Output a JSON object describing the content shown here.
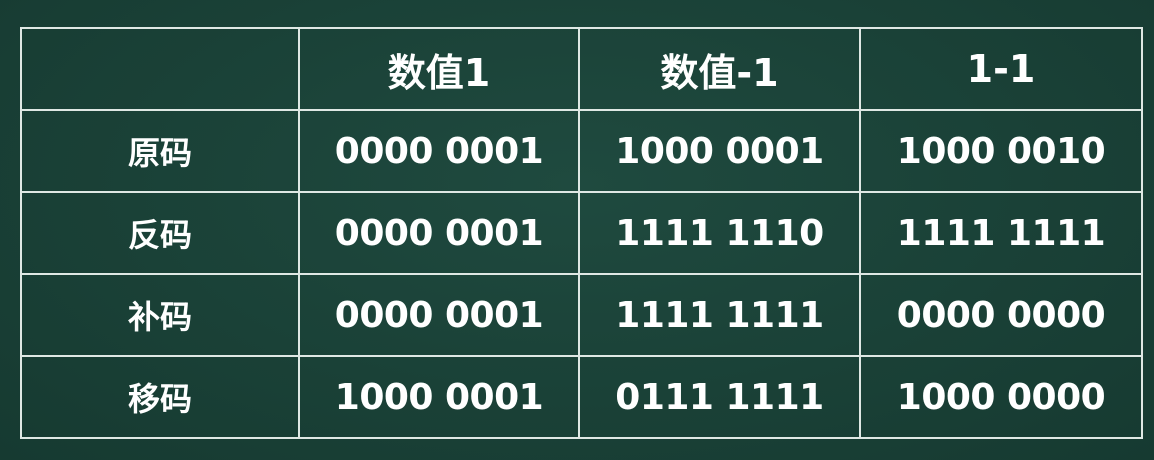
{
  "table": {
    "corner": "",
    "headers": [
      "数值1",
      "数值-1",
      "1-1"
    ],
    "rows": [
      {
        "label": "原码",
        "cells": [
          "0000 0001",
          "1000 0001",
          "1000 0010"
        ]
      },
      {
        "label": "反码",
        "cells": [
          "0000 0001",
          "1111 1110",
          "1111 1111"
        ]
      },
      {
        "label": "补码",
        "cells": [
          "0000 0001",
          "1111 1111",
          "0000 0000"
        ]
      },
      {
        "label": "移码",
        "cells": [
          "1000 0001",
          "0111 1111",
          "1000 0000"
        ]
      }
    ]
  },
  "colors": {
    "background": "#1a4137",
    "grid_line": "#dfe8e4",
    "text": "#ffffff"
  }
}
